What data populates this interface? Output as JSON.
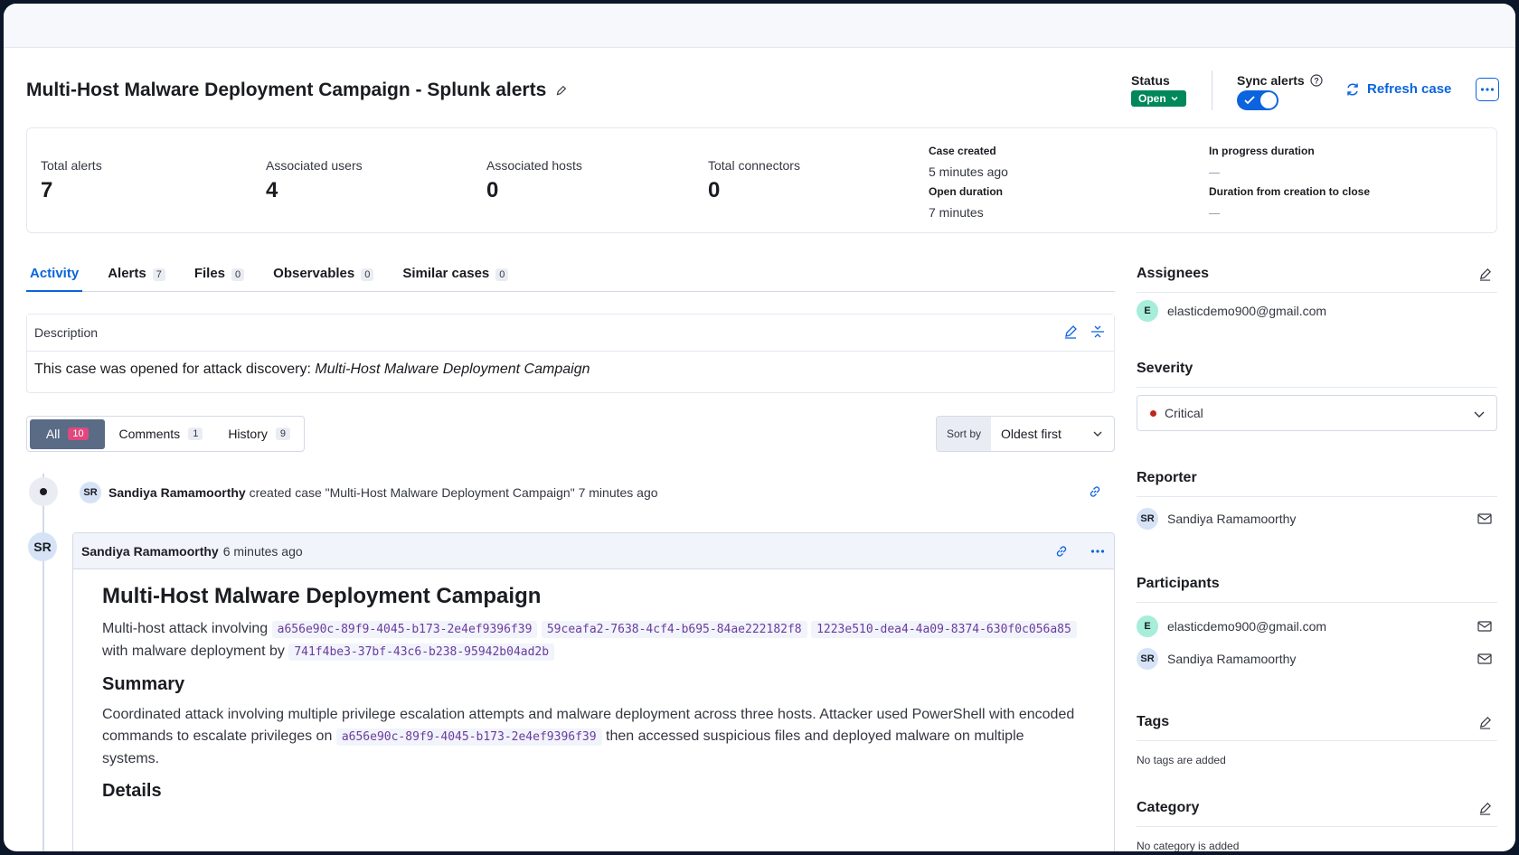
{
  "header": {
    "title": "Multi-Host Malware Deployment Campaign - Splunk alerts",
    "status_label": "Status",
    "status_value": "Open",
    "sync_label": "Sync alerts",
    "refresh_label": "Refresh case"
  },
  "metrics": {
    "total_alerts_label": "Total alerts",
    "total_alerts": "7",
    "users_label": "Associated users",
    "users": "4",
    "hosts_label": "Associated hosts",
    "hosts": "0",
    "connectors_label": "Total connectors",
    "connectors": "0",
    "case_created_label": "Case created",
    "case_created": "5 minutes ago",
    "open_duration_label": "Open duration",
    "open_duration": "7 minutes",
    "in_progress_label": "In progress duration",
    "creation_close_label": "Duration from creation to close"
  },
  "tabs": [
    {
      "label": "Activity",
      "count": ""
    },
    {
      "label": "Alerts",
      "count": "7"
    },
    {
      "label": "Files",
      "count": "0"
    },
    {
      "label": "Observables",
      "count": "0"
    },
    {
      "label": "Similar cases",
      "count": "0"
    }
  ],
  "description": {
    "label": "Description",
    "prefix": "This case was opened for attack discovery: ",
    "italic": "Multi-Host Malware Deployment Campaign"
  },
  "filter": {
    "all_label": "All",
    "all_count": "10",
    "comments_label": "Comments",
    "comments_count": "1",
    "history_label": "History",
    "history_count": "9",
    "sort_label": "Sort by",
    "sort_value": "Oldest first"
  },
  "timeline": {
    "event1": {
      "initials": "SR",
      "user": "Sandiya Ramamoorthy",
      "text": "created case \"Multi-Host Malware Deployment Campaign\" 7 minutes ago"
    },
    "comment": {
      "initials": "SR",
      "user": "Sandiya Ramamoorthy",
      "time": "6 minutes ago",
      "h1": "Multi-Host Malware Deployment Campaign",
      "p1_a": "Multi-host attack involving",
      "code1": "a656e90c-89f9-4045-b173-2e4ef9396f39",
      "code2": "59ceafa2-7638-4cf4-b695-84ae222182f8",
      "code3": "1223e510-dea4-4a09-8374-630f0c056a85",
      "p1_b": "with malware deployment by",
      "code4": "741f4be3-37bf-43c6-b238-95942b04ad2b",
      "h2_summary": "Summary",
      "p2_a": "Coordinated attack involving multiple privilege escalation attempts and malware deployment across three hosts. Attacker used PowerShell with encoded commands to escalate privileges on",
      "code5": "a656e90c-89f9-4045-b173-2e4ef9396f39",
      "p2_b": "then accessed suspicious files and deployed malware on multiple systems.",
      "h2_details": "Details"
    }
  },
  "sidebar": {
    "assignees_title": "Assignees",
    "assignee": {
      "initial": "E",
      "email": "elasticdemo900@gmail.com"
    },
    "severity_title": "Severity",
    "severity_value": "Critical",
    "reporter_title": "Reporter",
    "reporter": {
      "initials": "SR",
      "name": "Sandiya Ramamoorthy"
    },
    "participants_title": "Participants",
    "participants": [
      {
        "initials": "E",
        "name": "elasticdemo900@gmail.com"
      },
      {
        "initials": "SR",
        "name": "Sandiya Ramamoorthy"
      }
    ],
    "tags_title": "Tags",
    "tags_empty": "No tags are added",
    "category_title": "Category",
    "category_empty": "No category is added"
  },
  "colors": {
    "accent": "#0b64dd",
    "status_open": "#00875a",
    "critical": "#bd271e",
    "count_pink": "#e0487e"
  }
}
